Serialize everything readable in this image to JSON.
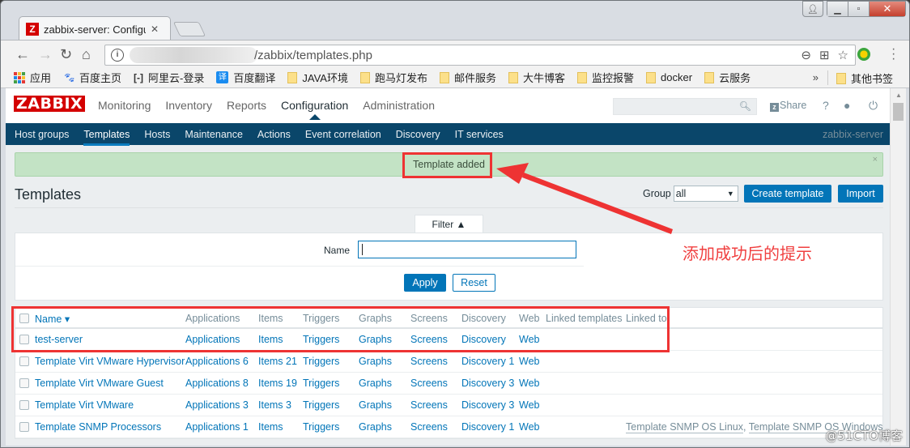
{
  "browser": {
    "tab_title": "zabbix-server: Configur",
    "tab_favicon": "Z",
    "url_visible": "/zabbix/templates.php",
    "window_controls": [
      "user-icon",
      "minimize-icon",
      "maximize-icon",
      "close-icon"
    ],
    "bookmarks": [
      {
        "label": "应用",
        "icon": "apps-icon"
      },
      {
        "label": "百度主页",
        "icon": "baidu-paw-icon"
      },
      {
        "label": "阿里云-登录",
        "icon": "aliyun-icon"
      },
      {
        "label": "百度翻译",
        "icon": "translate-icon"
      },
      {
        "label": "JAVA环境",
        "icon": "folder-icon"
      },
      {
        "label": "跑马灯发布",
        "icon": "folder-icon"
      },
      {
        "label": "邮件服务",
        "icon": "folder-icon"
      },
      {
        "label": "大牛博客",
        "icon": "folder-icon"
      },
      {
        "label": "监控报警",
        "icon": "folder-icon"
      },
      {
        "label": "docker",
        "icon": "folder-icon"
      },
      {
        "label": "云服务",
        "icon": "folder-icon"
      }
    ],
    "bookmarks_more": "»",
    "other_bookmarks": "其他书签"
  },
  "zabbix": {
    "logo": "ZABBIX",
    "main_menu": [
      {
        "label": "Monitoring",
        "active": false
      },
      {
        "label": "Inventory",
        "active": false
      },
      {
        "label": "Reports",
        "active": false
      },
      {
        "label": "Configuration",
        "active": true
      },
      {
        "label": "Administration",
        "active": false
      }
    ],
    "search_placeholder": "",
    "share_label": "Share",
    "help_label": "?",
    "sub_menu": [
      {
        "label": "Host groups",
        "active": false
      },
      {
        "label": "Templates",
        "active": true
      },
      {
        "label": "Hosts",
        "active": false
      },
      {
        "label": "Maintenance",
        "active": false
      },
      {
        "label": "Actions",
        "active": false
      },
      {
        "label": "Event correlation",
        "active": false
      },
      {
        "label": "Discovery",
        "active": false
      },
      {
        "label": "IT services",
        "active": false
      }
    ],
    "server_name": "zabbix-server",
    "message": "Template added",
    "message_close": "×",
    "page_title": "Templates",
    "group_label": "Group",
    "group_value": "all",
    "create_button": "Create template",
    "import_button": "Import",
    "filter": {
      "tab_label": "Filter ▲",
      "name_label": "Name",
      "name_value": "",
      "apply": "Apply",
      "reset": "Reset"
    },
    "table": {
      "headers": [
        "Name ▾",
        "Applications",
        "Items",
        "Triggers",
        "Graphs",
        "Screens",
        "Discovery",
        "Web",
        "Linked templates",
        "Linked to"
      ],
      "rows": [
        {
          "name": "test-server",
          "applications": "Applications",
          "items": "Items",
          "triggers": "Triggers",
          "graphs": "Graphs",
          "screens": "Screens",
          "discovery": "Discovery",
          "web": "Web",
          "linked_templates": "",
          "linked_to": ""
        },
        {
          "name": "Template Virt VMware Hypervisor",
          "applications": "Applications 6",
          "items": "Items 21",
          "triggers": "Triggers",
          "graphs": "Graphs",
          "screens": "Screens",
          "discovery": "Discovery 1",
          "web": "Web",
          "linked_templates": "",
          "linked_to": ""
        },
        {
          "name": "Template Virt VMware Guest",
          "applications": "Applications 8",
          "items": "Items 19",
          "triggers": "Triggers",
          "graphs": "Graphs",
          "screens": "Screens",
          "discovery": "Discovery 3",
          "web": "Web",
          "linked_templates": "",
          "linked_to": ""
        },
        {
          "name": "Template Virt VMware",
          "applications": "Applications 3",
          "items": "Items 3",
          "triggers": "Triggers",
          "graphs": "Graphs",
          "screens": "Screens",
          "discovery": "Discovery 3",
          "web": "Web",
          "linked_templates": "",
          "linked_to": ""
        },
        {
          "name": "Template SNMP Processors",
          "applications": "Applications 1",
          "items": "Items",
          "triggers": "Triggers",
          "graphs": "Graphs",
          "screens": "Screens",
          "discovery": "Discovery 1",
          "web": "Web",
          "linked_templates": "",
          "linked_to": "Template SNMP OS Linux, Template SNMP OS Windows"
        }
      ]
    }
  },
  "annotation": {
    "text": "添加成功后的提示",
    "color": "#ee3333"
  },
  "watermark": "@51CTO博客",
  "colors": {
    "brand_red": "#d40000",
    "nav_blue": "#0a466a",
    "link_blue": "#0275b8",
    "success_bg": "#c3e3c5"
  }
}
